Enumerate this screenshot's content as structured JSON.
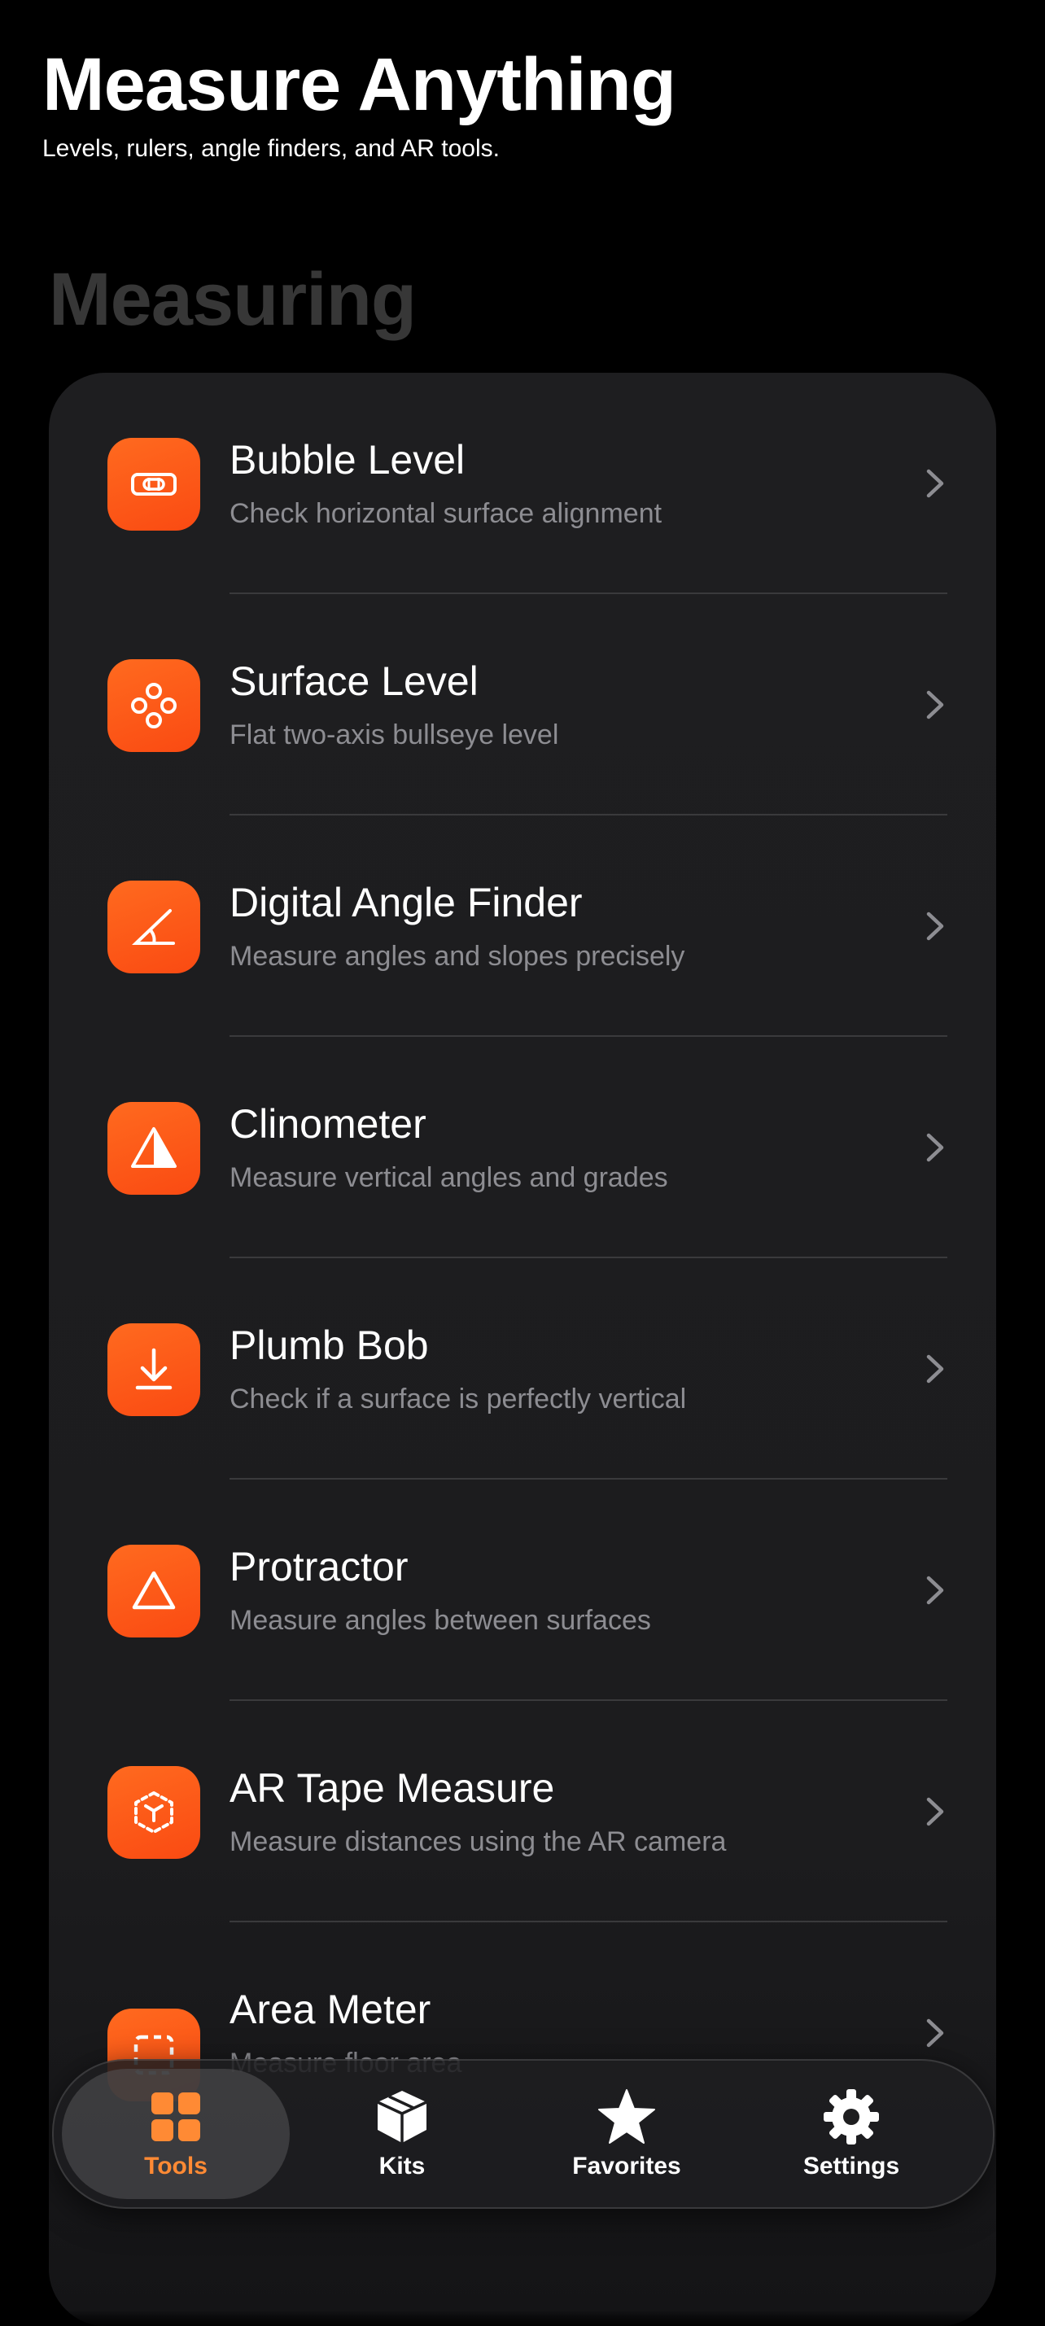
{
  "header": {
    "title": "Measure Anything",
    "subtitle": "Levels, rulers, angle finders, and AR tools."
  },
  "section": {
    "title": "Measuring"
  },
  "colors": {
    "accent": "#ff6a1f",
    "active_tab": "#ff8a34",
    "card": "#1c1c1e",
    "secondary_text": "#8d8d92"
  },
  "tools": [
    {
      "name": "Bubble Level",
      "description": "Check horizontal surface alignment",
      "icon": "level-icon"
    },
    {
      "name": "Surface Level",
      "description": "Flat two-axis bullseye level",
      "icon": "circles-icon"
    },
    {
      "name": "Digital Angle Finder",
      "description": "Measure angles and slopes precisely",
      "icon": "angle-icon"
    },
    {
      "name": "Clinometer",
      "description": "Measure vertical angles and grades",
      "icon": "triangle-half-icon"
    },
    {
      "name": "Plumb Bob",
      "description": "Check if a surface is perfectly vertical",
      "icon": "arrow-down-to-line-icon"
    },
    {
      "name": "Protractor",
      "description": "Measure angles between surfaces",
      "icon": "triangle-icon"
    },
    {
      "name": "AR Tape Measure",
      "description": "Measure distances using the AR camera",
      "icon": "ar-cube-icon"
    },
    {
      "name": "Area Meter",
      "description": "Measure floor area",
      "icon": "dashed-square-icon"
    }
  ],
  "tabs": [
    {
      "label": "Tools",
      "icon": "grid-icon",
      "active": true
    },
    {
      "label": "Kits",
      "icon": "box-icon",
      "active": false
    },
    {
      "label": "Favorites",
      "icon": "star-icon",
      "active": false
    },
    {
      "label": "Settings",
      "icon": "gear-icon",
      "active": false
    }
  ]
}
